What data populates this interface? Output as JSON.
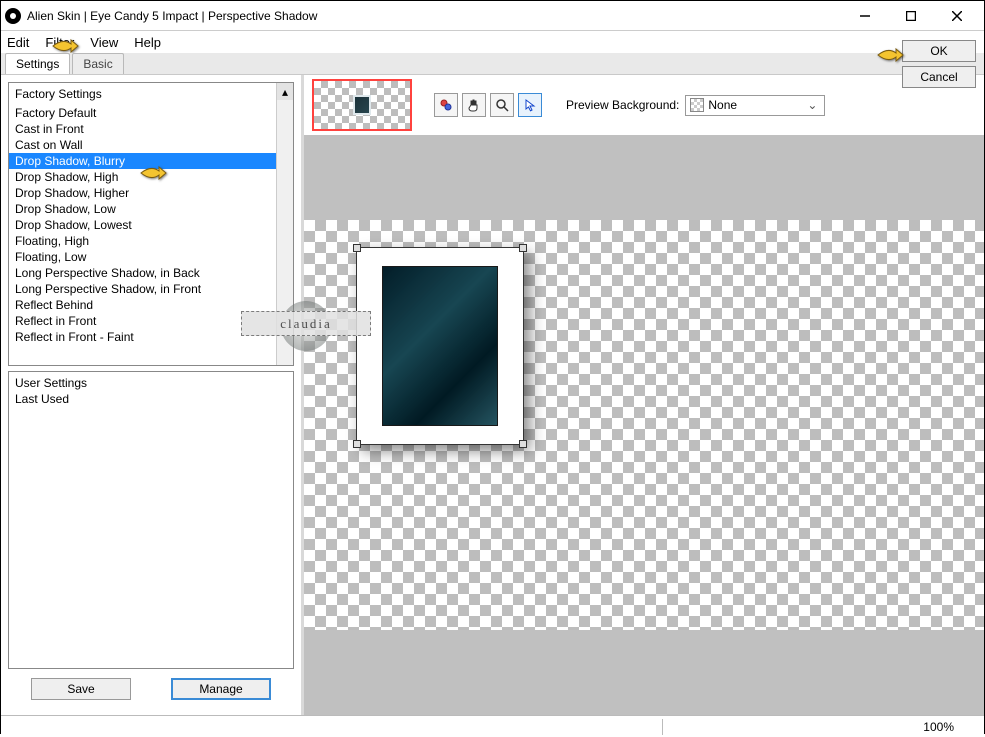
{
  "title": "Alien Skin | Eye Candy 5 Impact | Perspective Shadow",
  "menu": {
    "edit": "Edit",
    "filter": "Filter",
    "view": "View",
    "help": "Help"
  },
  "tabs": {
    "settings": "Settings",
    "basic": "Basic"
  },
  "factory": {
    "header": "Factory Settings",
    "items": [
      "Factory Default",
      "Cast in Front",
      "Cast on Wall",
      "Drop Shadow, Blurry",
      "Drop Shadow, High",
      "Drop Shadow, Higher",
      "Drop Shadow, Low",
      "Drop Shadow, Lowest",
      "Floating, High",
      "Floating, Low",
      "Long Perspective Shadow, in Back",
      "Long Perspective Shadow, in Front",
      "Reflect Behind",
      "Reflect in Front",
      "Reflect in Front - Faint"
    ],
    "selected_index": 3
  },
  "user": {
    "header": "User Settings",
    "items": [
      "Last Used"
    ]
  },
  "buttons": {
    "save": "Save",
    "manage": "Manage",
    "ok": "OK",
    "cancel": "Cancel"
  },
  "preview_bg": {
    "label": "Preview Background:",
    "value": "None"
  },
  "status": {
    "zoom": "100%"
  },
  "watermark": "claudia"
}
